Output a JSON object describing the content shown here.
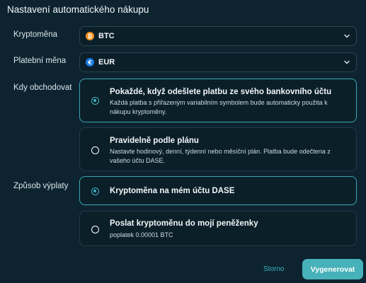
{
  "page": {
    "title": "Nastavení automatického nákupu"
  },
  "crypto": {
    "label": "Kryptoměna",
    "value": "BTC",
    "coin_symbol": "₿",
    "coin_color": "#f7931a",
    "icon": "bitcoin-icon"
  },
  "currency": {
    "label": "Platební měna",
    "value": "EUR",
    "coin_symbol": "€",
    "coin_color": "#1c7be3",
    "icon": "euro-icon"
  },
  "when": {
    "label": "Kdy obchodovat",
    "options": [
      {
        "title": "Pokaždé, když odešlete platbu ze svého bankovního účtu",
        "desc": "Každá platba s přiřazeným variabilním symbolem bude automaticky použita k nákupu kryptoměny.",
        "selected": true
      },
      {
        "title": "Pravidelně podle plánu",
        "desc": "Nastavte hodinový, denní, týdenní nebo měsíční plán. Platba bude odečtena z vašeho účtu DASE.",
        "selected": false
      }
    ]
  },
  "payout": {
    "label": "Způsob výplaty",
    "options": [
      {
        "title": "Kryptoměna na mém účtu DASE",
        "selected": true
      },
      {
        "title": "Poslat kryptoměnu do mojí peněženky",
        "desc": "poplatek 0.00001 BTC",
        "selected": false
      }
    ]
  },
  "actions": {
    "cancel": "Storno",
    "generate": "Vygenerovat"
  },
  "colors": {
    "background": "#0d2430",
    "accent": "#3fb3bf",
    "button": "#47b1b9"
  }
}
